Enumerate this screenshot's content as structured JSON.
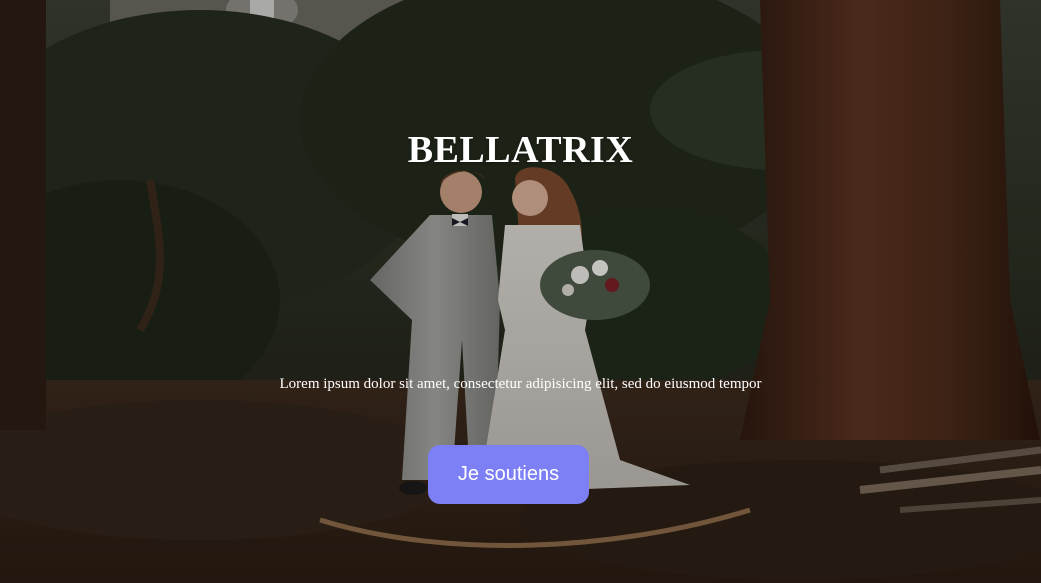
{
  "hero": {
    "title": "BELLATRIX",
    "tagline": "Lorem ipsum dolor sit amet, consectetur adipisicing elit, sed do eiusmod tempor",
    "cta_label": "Je soutiens",
    "background_image": "wedding-couple-forest-photo"
  },
  "colors": {
    "cta_background": "#7d7ff5",
    "text": "#ffffff"
  }
}
